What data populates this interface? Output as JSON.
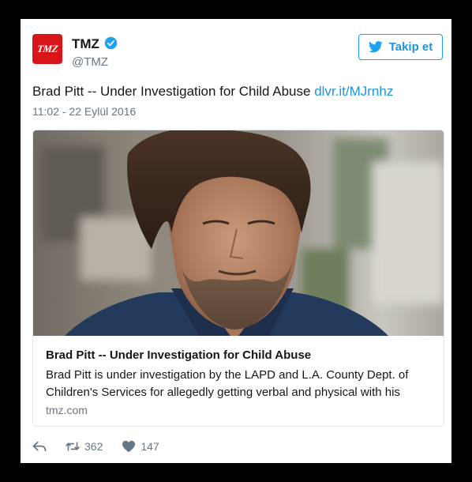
{
  "tweet": {
    "author_name": "TMZ",
    "author_handle": "@TMZ",
    "avatar_text": "TMZ",
    "follow_label": "Takip et",
    "text": "Brad Pitt -- Under Investigation for Child Abuse ",
    "link_text": "dlvr.it/MJrnhz",
    "timestamp": "11:02 - 22 Eylül 2016"
  },
  "card": {
    "title": "Brad Pitt -- Under Investigation for Child Abuse",
    "description": "Brad Pitt is under investigation by the LAPD and L.A. County Dept. of Children's Services for allegedly getting verbal and physical with his",
    "domain": "tmz.com"
  },
  "actions": {
    "retweet_count": "362",
    "like_count": "147"
  },
  "icons": {
    "verified": "verified-badge-icon",
    "bird": "twitter-bird-icon",
    "reply": "reply-icon",
    "retweet": "retweet-icon",
    "like": "heart-icon"
  },
  "colors": {
    "brand_blue": "#1da1f2",
    "tmz_red": "#d8161a",
    "muted": "#657786"
  }
}
